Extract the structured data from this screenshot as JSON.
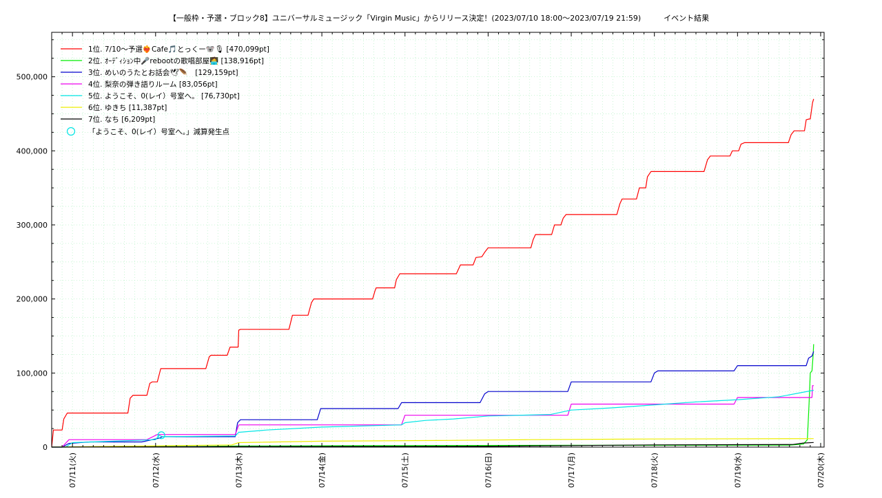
{
  "chart_data": {
    "type": "line",
    "title": "【一般枠・予選・ブロック8】ユニバーサルミュージック「Virgin Music」からリリース決定！(2023/07/10 18:00～2023/07/19 21:59)　　　イベント結果",
    "ylim": [
      0,
      560000
    ],
    "yticks": [
      {
        "value": 0,
        "label": "0"
      },
      {
        "value": 100000,
        "label": "100,000"
      },
      {
        "value": 200000,
        "label": "200,000"
      },
      {
        "value": 300000,
        "label": "300,000"
      },
      {
        "value": 400000,
        "label": "400,000"
      },
      {
        "value": 500000,
        "label": "500,000"
      }
    ],
    "xlim": [
      "2023-07-10 18:00",
      "2023-07-20 01:00"
    ],
    "xticks": [
      {
        "value": "2023-07-11 00:00",
        "label": "07/11(火)"
      },
      {
        "value": "2023-07-12 00:00",
        "label": "07/12(水)"
      },
      {
        "value": "2023-07-13 00:00",
        "label": "07/13(木)"
      },
      {
        "value": "2023-07-14 00:00",
        "label": "07/14(金)"
      },
      {
        "value": "2023-07-15 00:00",
        "label": "07/15(土)"
      },
      {
        "value": "2023-07-16 00:00",
        "label": "07/16(日)"
      },
      {
        "value": "2023-07-17 00:00",
        "label": "07/17(月)"
      },
      {
        "value": "2023-07-18 00:00",
        "label": "07/18(火)"
      },
      {
        "value": "2023-07-19 00:00",
        "label": "07/19(水)"
      },
      {
        "value": "2023-07-20 00:00",
        "label": "07/20(木)"
      }
    ],
    "grid": true,
    "legend_position": "top-left",
    "series": [
      {
        "name": "1位. 7/10～予選❤️‍🔥Cafe🎵とっくー🐨🎙 [470,099pt]",
        "color": "#ff0000",
        "points": [
          [
            "2023-07-10 18:00",
            0
          ],
          [
            "2023-07-10 18:30",
            23000
          ],
          [
            "2023-07-10 21:00",
            23000
          ],
          [
            "2023-07-10 21:30",
            38000
          ],
          [
            "2023-07-10 22:30",
            46000
          ],
          [
            "2023-07-11 16:00",
            46000
          ],
          [
            "2023-07-11 16:40",
            66000
          ],
          [
            "2023-07-11 17:30",
            70000
          ],
          [
            "2023-07-11 21:30",
            70000
          ],
          [
            "2023-07-11 22:20",
            86000
          ],
          [
            "2023-07-11 23:00",
            88000
          ],
          [
            "2023-07-12 00:30",
            88000
          ],
          [
            "2023-07-12 01:30",
            106000
          ],
          [
            "2023-07-12 14:30",
            106000
          ],
          [
            "2023-07-12 15:30",
            122000
          ],
          [
            "2023-07-12 16:00",
            124000
          ],
          [
            "2023-07-12 20:40",
            124000
          ],
          [
            "2023-07-12 21:30",
            135000
          ],
          [
            "2023-07-12 22:00",
            135000
          ],
          [
            "2023-07-12 23:50",
            135000
          ],
          [
            "2023-07-13 00:00",
            158000
          ],
          [
            "2023-07-13 00:30",
            159000
          ],
          [
            "2023-07-13 14:30",
            159000
          ],
          [
            "2023-07-13 15:30",
            178000
          ],
          [
            "2023-07-13 20:00",
            178000
          ],
          [
            "2023-07-13 21:00",
            195000
          ],
          [
            "2023-07-13 21:40",
            200000
          ],
          [
            "2023-07-14 14:40",
            200000
          ],
          [
            "2023-07-14 15:20",
            211000
          ],
          [
            "2023-07-14 15:40",
            215000
          ],
          [
            "2023-07-14 21:00",
            215000
          ],
          [
            "2023-07-14 21:30",
            226000
          ],
          [
            "2023-07-14 22:30",
            234000
          ],
          [
            "2023-07-15 14:50",
            234000
          ],
          [
            "2023-07-15 16:00",
            246000
          ],
          [
            "2023-07-15 19:40",
            246000
          ],
          [
            "2023-07-15 20:30",
            256000
          ],
          [
            "2023-07-15 22:10",
            257000
          ],
          [
            "2023-07-15 23:00",
            263000
          ],
          [
            "2023-07-16 00:00",
            269000
          ],
          [
            "2023-07-16 12:20",
            269000
          ],
          [
            "2023-07-16 13:00",
            280000
          ],
          [
            "2023-07-16 13:40",
            287000
          ],
          [
            "2023-07-16 18:20",
            287000
          ],
          [
            "2023-07-16 19:10",
            300000
          ],
          [
            "2023-07-16 21:00",
            300000
          ],
          [
            "2023-07-16 21:40",
            309000
          ],
          [
            "2023-07-16 22:30",
            314000
          ],
          [
            "2023-07-17 13:10",
            314000
          ],
          [
            "2023-07-17 14:00",
            328000
          ],
          [
            "2023-07-17 14:40",
            335000
          ],
          [
            "2023-07-17 18:50",
            335000
          ],
          [
            "2023-07-17 19:40",
            350000
          ],
          [
            "2023-07-17 21:30",
            350000
          ],
          [
            "2023-07-17 22:00",
            365000
          ],
          [
            "2023-07-17 23:00",
            372000
          ],
          [
            "2023-07-18 14:20",
            372000
          ],
          [
            "2023-07-18 15:20",
            388000
          ],
          [
            "2023-07-18 16:10",
            393000
          ],
          [
            "2023-07-18 21:50",
            393000
          ],
          [
            "2023-07-18 22:30",
            400000
          ],
          [
            "2023-07-19 00:20",
            400000
          ],
          [
            "2023-07-19 01:00",
            409000
          ],
          [
            "2023-07-19 02:00",
            411000
          ],
          [
            "2023-07-19 14:40",
            411000
          ],
          [
            "2023-07-19 15:30",
            422000
          ],
          [
            "2023-07-19 16:20",
            427000
          ],
          [
            "2023-07-19 19:20",
            427000
          ],
          [
            "2023-07-19 19:50",
            442000
          ],
          [
            "2023-07-19 20:40",
            443000
          ],
          [
            "2023-07-19 21:00",
            443000
          ],
          [
            "2023-07-19 21:40",
            465000
          ],
          [
            "2023-07-19 21:59",
            470099
          ]
        ]
      },
      {
        "name": "2位. ｵｰﾃﾞｨｼｮﾝ中🎤rebootの歌唱部屋🧑‍💻 [138,916pt]",
        "color": "#00ee00",
        "points": [
          [
            "2023-07-10 18:00",
            0
          ],
          [
            "2023-07-12 12:00",
            800
          ],
          [
            "2023-07-13 00:00",
            1500
          ],
          [
            "2023-07-15 00:00",
            2000
          ],
          [
            "2023-07-17 00:00",
            2400
          ],
          [
            "2023-07-19 15:00",
            2600
          ],
          [
            "2023-07-19 19:00",
            4000
          ],
          [
            "2023-07-19 20:10",
            10000
          ],
          [
            "2023-07-19 20:40",
            60000
          ],
          [
            "2023-07-19 21:00",
            100000
          ],
          [
            "2023-07-19 21:30",
            103000
          ],
          [
            "2023-07-19 21:50",
            125000
          ],
          [
            "2023-07-19 21:59",
            138916
          ]
        ]
      },
      {
        "name": "3位. めいのうたとお話会🕊🪶　[129,159pt]",
        "color": "#0000cc",
        "points": [
          [
            "2023-07-10 18:00",
            0
          ],
          [
            "2023-07-10 21:00",
            0
          ],
          [
            "2023-07-10 23:00",
            5000
          ],
          [
            "2023-07-11 05:00",
            7000
          ],
          [
            "2023-07-11 20:00",
            7000
          ],
          [
            "2023-07-12 01:00",
            12000
          ],
          [
            "2023-07-12 02:00",
            14000
          ],
          [
            "2023-07-12 23:00",
            14000
          ],
          [
            "2023-07-12 23:40",
            33000
          ],
          [
            "2023-07-13 00:30",
            37000
          ],
          [
            "2023-07-13 22:40",
            37000
          ],
          [
            "2023-07-13 23:40",
            52000
          ],
          [
            "2023-07-14 22:00",
            52000
          ],
          [
            "2023-07-14 23:00",
            60000
          ],
          [
            "2023-07-15 21:40",
            60000
          ],
          [
            "2023-07-15 23:00",
            72000
          ],
          [
            "2023-07-16 00:00",
            75000
          ],
          [
            "2023-07-16 23:00",
            75000
          ],
          [
            "2023-07-17 00:00",
            88000
          ],
          [
            "2023-07-17 23:00",
            88000
          ],
          [
            "2023-07-18 00:00",
            100000
          ],
          [
            "2023-07-18 01:00",
            103000
          ],
          [
            "2023-07-18 23:00",
            103000
          ],
          [
            "2023-07-19 00:00",
            110000
          ],
          [
            "2023-07-19 19:50",
            110000
          ],
          [
            "2023-07-19 20:30",
            120000
          ],
          [
            "2023-07-19 21:30",
            123000
          ],
          [
            "2023-07-19 21:59",
            129159
          ]
        ]
      },
      {
        "name": "4位. 梨奈の弾き語りルーム [83,056pt]",
        "color": "#ee00ee",
        "points": [
          [
            "2023-07-10 18:00",
            0
          ],
          [
            "2023-07-10 21:00",
            0
          ],
          [
            "2023-07-10 23:00",
            10000
          ],
          [
            "2023-07-11 21:30",
            10000
          ],
          [
            "2023-07-12 00:30",
            17000
          ],
          [
            "2023-07-12 23:00",
            17000
          ],
          [
            "2023-07-13 00:00",
            30000
          ],
          [
            "2023-07-14 23:00",
            30000
          ],
          [
            "2023-07-15 00:00",
            43000
          ],
          [
            "2023-07-16 23:00",
            43000
          ],
          [
            "2023-07-17 00:00",
            58000
          ],
          [
            "2023-07-18 23:00",
            58000
          ],
          [
            "2023-07-19 00:00",
            67000
          ],
          [
            "2023-07-19 21:30",
            67000
          ],
          [
            "2023-07-19 21:40",
            83056
          ],
          [
            "2023-07-19 21:59",
            83056
          ]
        ]
      },
      {
        "name": "5位. ようこそ、0(レイ）号室へ。 [76,730pt]",
        "color": "#00e5e5",
        "points": [
          [
            "2023-07-10 18:00",
            0
          ],
          [
            "2023-07-10 22:00",
            0
          ],
          [
            "2023-07-11 00:00",
            6000
          ],
          [
            "2023-07-12 00:00",
            10000
          ],
          [
            "2023-07-12 01:00",
            16000
          ],
          [
            "2023-07-12 02:00",
            14000
          ],
          [
            "2023-07-12 23:00",
            15000
          ],
          [
            "2023-07-13 00:00",
            20000
          ],
          [
            "2023-07-13 08:00",
            23000
          ],
          [
            "2023-07-14 00:00",
            27000
          ],
          [
            "2023-07-14 23:00",
            30000
          ],
          [
            "2023-07-15 00:00",
            33000
          ],
          [
            "2023-07-15 06:00",
            36000
          ],
          [
            "2023-07-15 14:00",
            38000
          ],
          [
            "2023-07-16 00:00",
            42000
          ],
          [
            "2023-07-16 18:00",
            44000
          ],
          [
            "2023-07-17 00:00",
            50000
          ],
          [
            "2023-07-17 12:00",
            53000
          ],
          [
            "2023-07-18 00:00",
            57000
          ],
          [
            "2023-07-18 12:00",
            61000
          ],
          [
            "2023-07-19 00:00",
            64000
          ],
          [
            "2023-07-19 12:00",
            68000
          ],
          [
            "2023-07-19 21:59",
            76730
          ]
        ]
      },
      {
        "name": "6位. ゆきち [11,387pt]",
        "color": "#eeee00",
        "points": [
          [
            "2023-07-10 18:00",
            0
          ],
          [
            "2023-07-11 12:00",
            1000
          ],
          [
            "2023-07-12 22:00",
            3000
          ],
          [
            "2023-07-13 00:00",
            6000
          ],
          [
            "2023-07-14 00:00",
            8000
          ],
          [
            "2023-07-15 12:00",
            9000
          ],
          [
            "2023-07-16 12:00",
            10000
          ],
          [
            "2023-07-18 00:00",
            11000
          ],
          [
            "2023-07-19 21:59",
            11387
          ]
        ]
      },
      {
        "name": "7位. なち [6,209pt]",
        "color": "#000000",
        "points": [
          [
            "2023-07-10 18:00",
            0
          ],
          [
            "2023-07-13 00:00",
            700
          ],
          [
            "2023-07-16 00:00",
            1000
          ],
          [
            "2023-07-17 00:00",
            2000
          ],
          [
            "2023-07-18 00:00",
            3000
          ],
          [
            "2023-07-19 16:00",
            3500
          ],
          [
            "2023-07-19 19:00",
            5500
          ],
          [
            "2023-07-19 21:59",
            6209
          ]
        ]
      }
    ],
    "markers": {
      "name": "「ようこそ、0(レイ）号室へ。」減算発生点",
      "color": "#00e5e5",
      "points": [
        [
          "2023-07-12 01:40",
          16000
        ]
      ]
    }
  }
}
